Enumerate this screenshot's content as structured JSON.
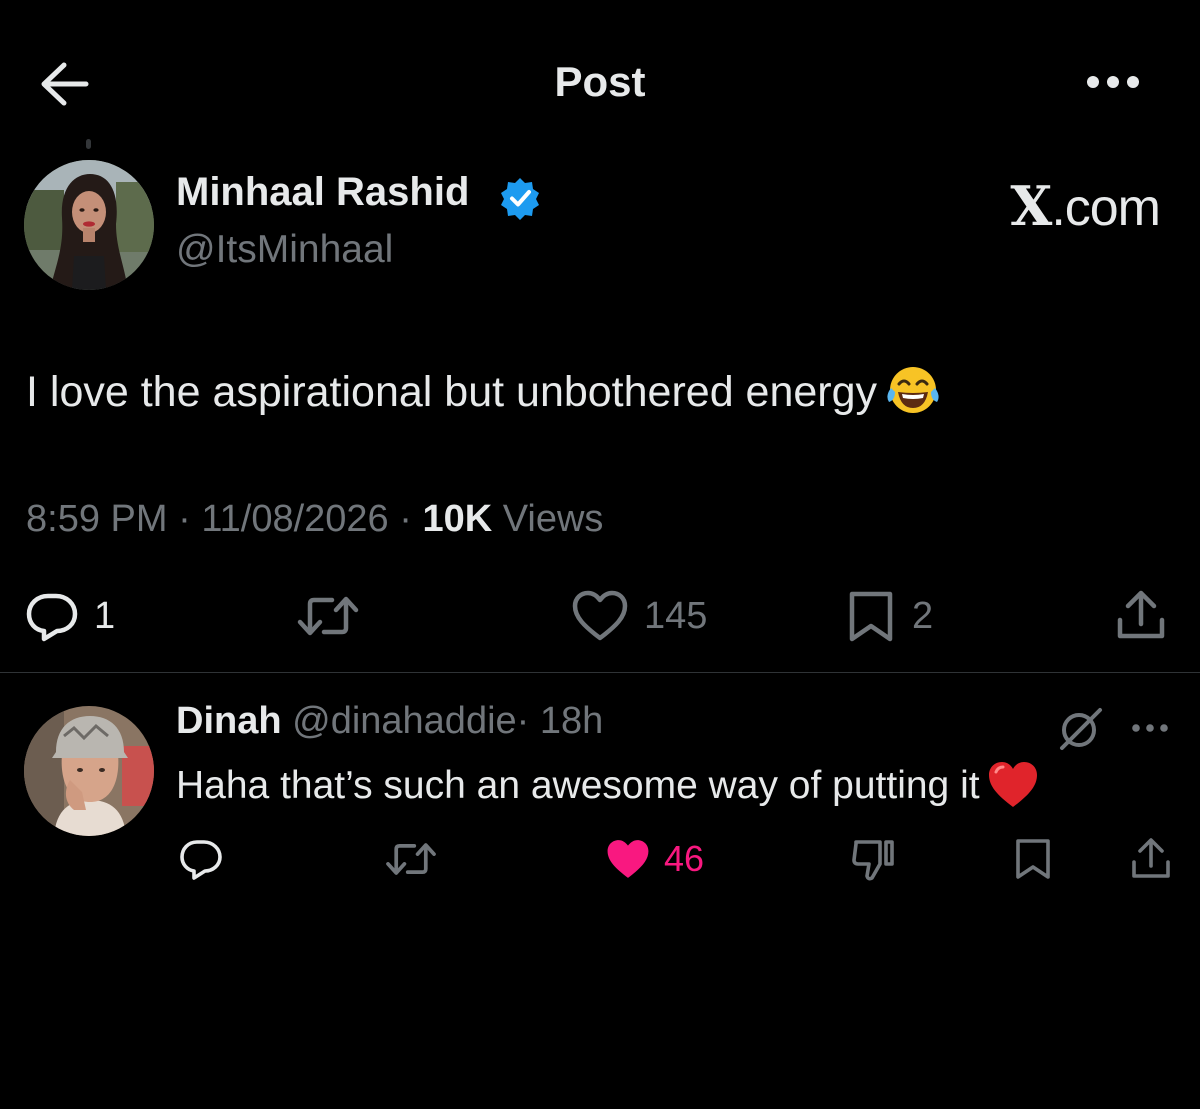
{
  "header": {
    "title": "Post",
    "back_icon": "arrow-left-icon",
    "more_icon": "more-horizontal-icon"
  },
  "post": {
    "author_name": "Minhaal Rashid",
    "author_handle": "@ItsMinhaal",
    "verified": true,
    "verified_color": "#1d9bf0",
    "watermark": "X.com",
    "text": "I love the aspirational but unbothered energy",
    "text_emoji": "face-with-tears-of-joy-emoji",
    "time": "8:59 PM",
    "date": "11/08/2026",
    "views_count": "10K",
    "views_label": "Views",
    "separator": "·",
    "actions": {
      "reply_count": "1",
      "retweet_count": "",
      "like_count": "145",
      "bookmark_count": "2"
    }
  },
  "reply": {
    "author_name": "Dinah",
    "author_handle": "@dinahaddie",
    "separator": "·",
    "time": "18h",
    "text": "Haha that’s such an awesome way of putting it",
    "text_emoji": "red-heart-emoji",
    "actions": {
      "like_count": "46",
      "liked": true
    }
  },
  "colors": {
    "background": "#000000",
    "primary_text": "#e7e9ea",
    "secondary_text": "#71767b",
    "divider": "#2f3336",
    "like_active": "#f91880",
    "verified": "#1d9bf0"
  }
}
